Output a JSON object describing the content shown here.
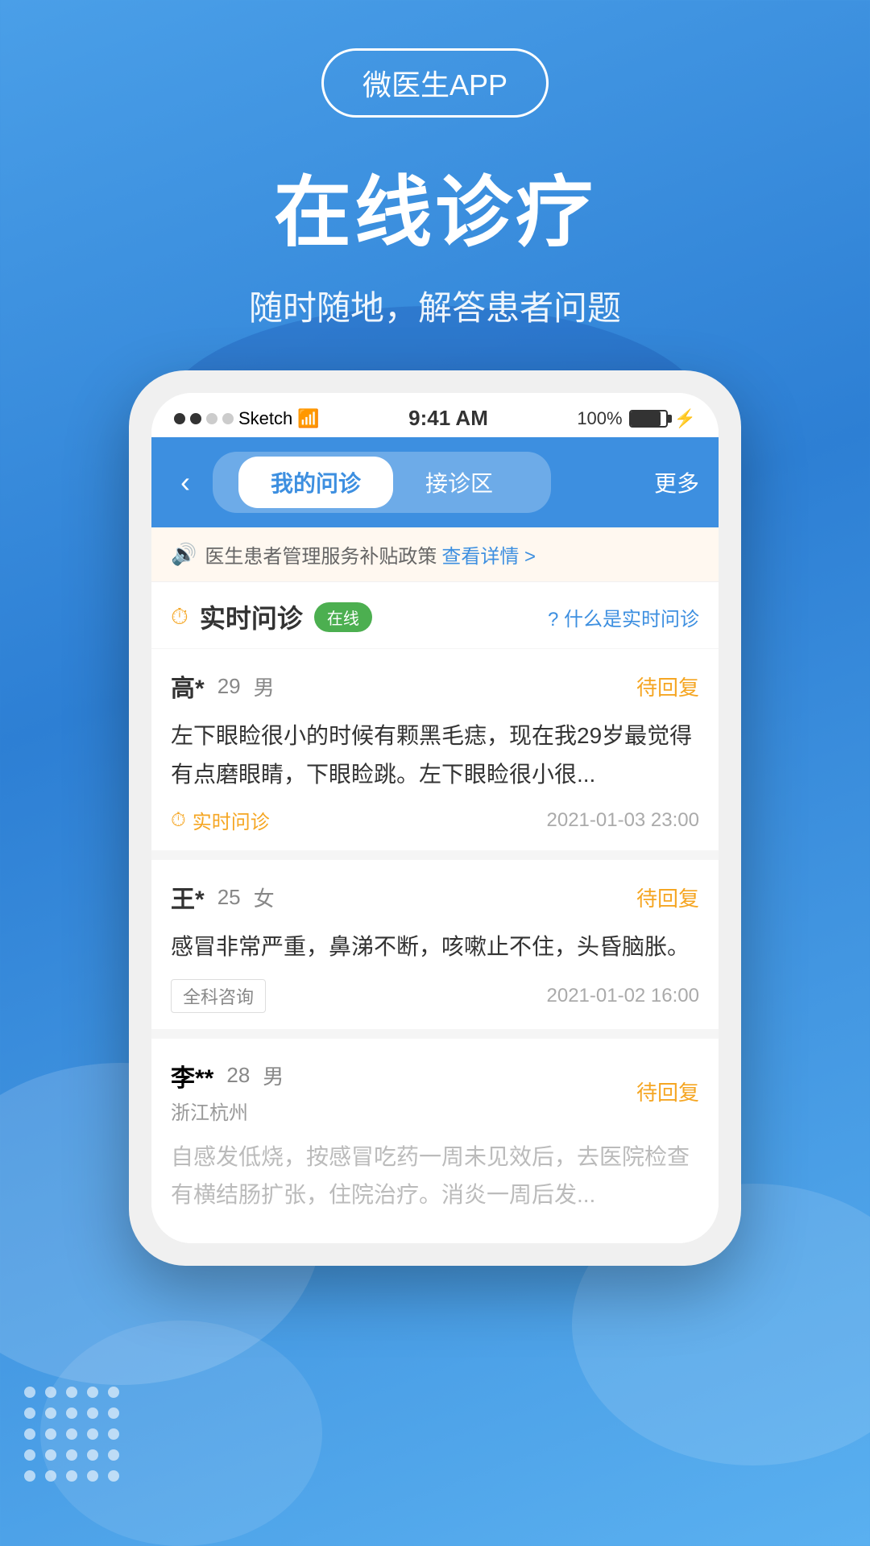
{
  "app": {
    "badge_label": "微医生APP",
    "main_title": "在线诊疗",
    "sub_title": "随时随地，解答患者问题"
  },
  "status_bar": {
    "carrier": "Sketch",
    "time": "9:41 AM",
    "battery": "100%"
  },
  "nav": {
    "back_label": "‹",
    "tab1_label": "我的问诊",
    "tab2_label": "接诊区",
    "more_label": "更多"
  },
  "notice": {
    "text": "医生患者管理服务补贴政策",
    "link_text": "查看详情 >"
  },
  "section": {
    "title": "实时问诊",
    "online_badge": "在线",
    "what_is_label": "? 什么是实时问诊"
  },
  "cards": [
    {
      "patient_name": "高*",
      "patient_age": "29",
      "patient_gender": "男",
      "status": "待回复",
      "content": "左下眼睑很小的时候有颗黑毛痣，现在我29岁最觉得有点磨眼睛，下眼睑跳。左下眼睑很小很...",
      "tag": "实时问诊",
      "timestamp": "2021-01-03 23:00",
      "tag_type": "realtime"
    },
    {
      "patient_name": "王*",
      "patient_age": "25",
      "patient_gender": "女",
      "status": "待回复",
      "content": "感冒非常严重，鼻涕不断，咳嗽止不住，头昏脑胀。",
      "tag": "全科咨询",
      "timestamp": "2021-01-02 16:00",
      "tag_type": "normal"
    },
    {
      "patient_name": "李**",
      "patient_age": "28",
      "patient_gender": "男",
      "patient_location": "浙江杭州",
      "status": "待回复",
      "content": "自感发低烧，按感冒吃药一周未见效后，去医院检查有横结肠扩张，住院治疗。消炎一周后发...",
      "tag": "",
      "timestamp": "",
      "tag_type": "gray"
    }
  ]
}
